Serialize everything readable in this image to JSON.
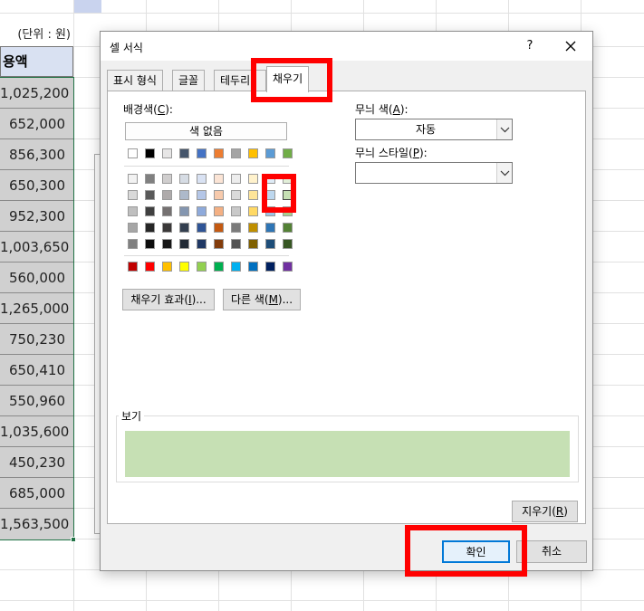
{
  "sheet": {
    "unit_label": "(단위 : 원)",
    "header": "용액",
    "amounts": [
      "1,025,200",
      "652,000",
      "856,300",
      "650,300",
      "952,300",
      "1,003,650",
      "560,000",
      "1,265,000",
      "750,230",
      "650,410",
      "550,960",
      "1,035,600",
      "450,230",
      "685,000",
      "1,563,500"
    ]
  },
  "dialog": {
    "title": "셀 서식",
    "help": "?",
    "tabs": [
      {
        "label": "표시 형식"
      },
      {
        "label": "글꼴"
      },
      {
        "label": "테두리"
      },
      {
        "label": "채우기",
        "active": true
      }
    ],
    "background_color": {
      "label_pre": "배경색(",
      "hotkey": "C",
      "label_post": "):"
    },
    "no_color_label": "색 없음",
    "fill_effects": {
      "pre": "채우기 효과(",
      "hotkey": "I",
      "post": ")..."
    },
    "more_colors": {
      "pre": "다른 색(",
      "hotkey": "M",
      "post": ")..."
    },
    "pattern_color": {
      "pre": "무늬 색(",
      "hotkey": "A",
      "post": "):",
      "value": "자동"
    },
    "pattern_style": {
      "pre": "무늬 스타일(",
      "hotkey": "P",
      "post": "):",
      "value": ""
    },
    "preview_label": "보기",
    "preview_color": "#C6E0B4",
    "clear": {
      "pre": "지우기(",
      "hotkey": "R",
      "post": ")"
    },
    "ok_label": "확인",
    "cancel_label": "취소",
    "selected_color": "#C6E0B4"
  },
  "palette": {
    "theme_top": [
      "#FFFFFF",
      "#000000",
      "#E7E6E6",
      "#44546A",
      "#4472C4",
      "#ED7D31",
      "#A5A5A5",
      "#FFC000",
      "#5B9BD5",
      "#70AD47"
    ],
    "tints": [
      [
        "#F2F2F2",
        "#808080",
        "#D0CECE",
        "#D6DCE4",
        "#D9E2F3",
        "#FBE4D5",
        "#EDEDED",
        "#FFF2CC",
        "#DEEBF6",
        "#E2EFD9"
      ],
      [
        "#D9D9D9",
        "#595959",
        "#AEAAAA",
        "#ADB9CA",
        "#B4C6E7",
        "#F7CAAC",
        "#DBDBDB",
        "#FEE599",
        "#BDD7EE",
        "#C6E0B4"
      ],
      [
        "#BFBFBF",
        "#404040",
        "#757171",
        "#8496B0",
        "#8EAADB",
        "#F4B083",
        "#C9C9C9",
        "#FFD965",
        "#9CC3E5",
        "#A8D08D"
      ],
      [
        "#A6A6A6",
        "#262626",
        "#3A3838",
        "#333F4F",
        "#2F5496",
        "#C45911",
        "#7B7B7B",
        "#BF8F00",
        "#2E75B5",
        "#538135"
      ],
      [
        "#808080",
        "#0D0D0D",
        "#161616",
        "#222A35",
        "#1F3864",
        "#833C0B",
        "#525252",
        "#7F6000",
        "#1E4E79",
        "#375623"
      ]
    ],
    "standard": [
      "#C00000",
      "#FF0000",
      "#FFC000",
      "#FFFF00",
      "#92D050",
      "#00B050",
      "#00B0F0",
      "#0070C0",
      "#002060",
      "#7030A0"
    ]
  },
  "highlights": {
    "color": "#FF0000"
  }
}
